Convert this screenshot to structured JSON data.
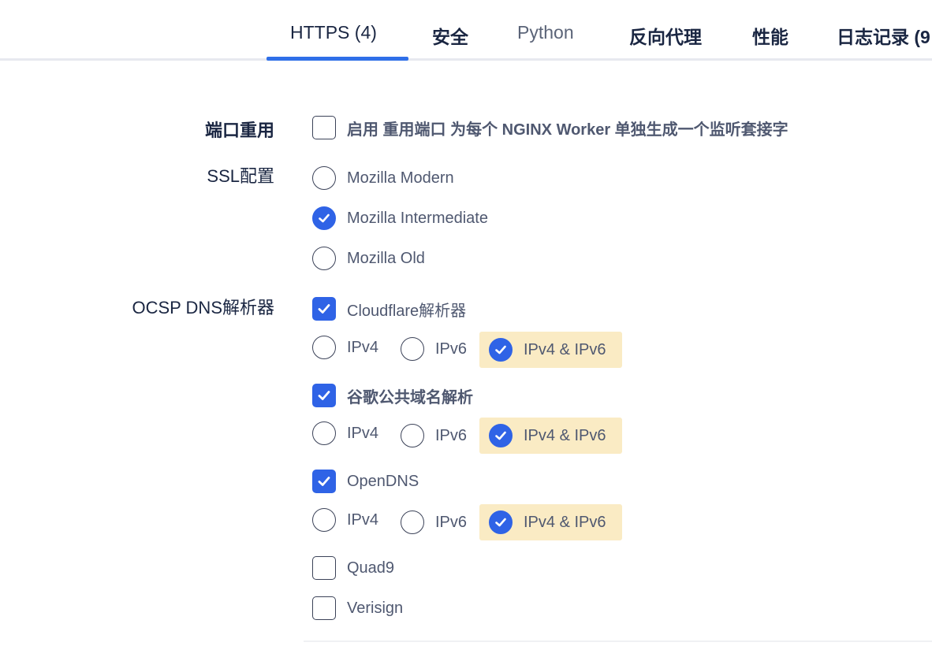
{
  "tabs": [
    {
      "label": "HTTPS (4)",
      "active": true
    },
    {
      "label": "安全"
    },
    {
      "label": "Python"
    },
    {
      "label": "反向代理"
    },
    {
      "label": "性能"
    },
    {
      "label": "日志记录 (9"
    }
  ],
  "port_reuse": {
    "label": "端口重用",
    "checkbox_label": "启用 重用端口 为每个 NGINX Worker 单独生成一个监听套接字",
    "checked": false
  },
  "ssl_config": {
    "label": "SSL配置",
    "options": [
      {
        "label": "Mozilla Modern",
        "selected": false
      },
      {
        "label": "Mozilla Intermediate",
        "selected": true
      },
      {
        "label": "Mozilla Old",
        "selected": false
      }
    ]
  },
  "ocsp": {
    "label": "OCSP DNS解析器",
    "resolvers": [
      {
        "label": "Cloudflare解析器",
        "checked": true,
        "ipv4": "IPv4",
        "ipv6": "IPv6",
        "both": "IPv4 & IPv6",
        "selected": "both"
      },
      {
        "label": "谷歌公共域名解析",
        "checked": true,
        "ipv4": "IPv4",
        "ipv6": "IPv6",
        "both": "IPv4 & IPv6",
        "selected": "both"
      },
      {
        "label": "OpenDNS",
        "checked": true,
        "ipv4": "IPv4",
        "ipv6": "IPv6",
        "both": "IPv4 & IPv6",
        "selected": "both"
      },
      {
        "label": "Quad9",
        "checked": false
      },
      {
        "label": "Verisign",
        "checked": false
      }
    ]
  },
  "colors": {
    "accent": "#2f63e6",
    "highlight": "#faebc4",
    "tab_underline": "#2f6fe8"
  }
}
